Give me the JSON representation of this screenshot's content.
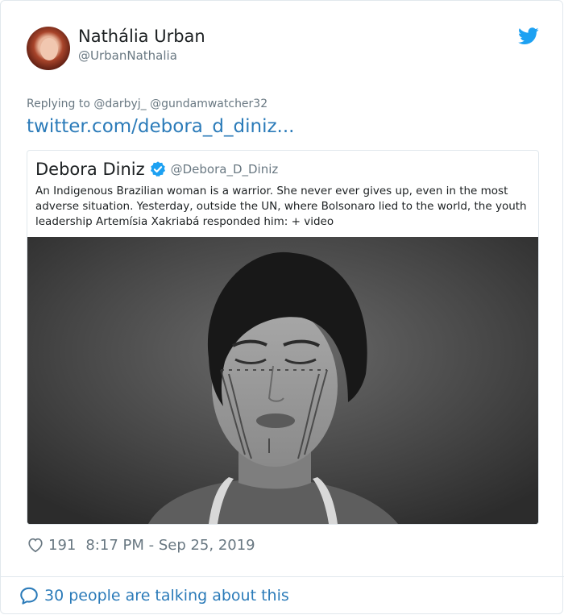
{
  "tweet": {
    "author_name": "Nathália Urban",
    "author_handle": "@UrbanNathalia",
    "replying_to": "Replying to @darbyj_ @gundamwatcher32",
    "link_text": "twitter.com/debora_d_diniz...",
    "likes": "191",
    "timestamp": "8:17 PM - Sep 25, 2019",
    "talking": "30 people are talking about this"
  },
  "quoted_tweet": {
    "author_name": "Debora Diniz",
    "author_handle": "@Debora_D_Diniz",
    "text": "An Indigenous Brazilian woman is a warrior. She never ever gives up, even in the most adverse situation. Yesterday, outside the UN, where Bolsonaro lied to the world, the youth leadership Artemísia Xakriabá responded him: + video"
  },
  "icons": {
    "brand": "twitter-bird-icon",
    "verified": "verified-badge-icon",
    "like": "heart-icon",
    "talk": "speech-bubble-icon"
  },
  "colors": {
    "link": "#2b7bb9",
    "twitter_blue": "#1da1f2",
    "muted": "#697882",
    "border": "#e1e8ed"
  }
}
